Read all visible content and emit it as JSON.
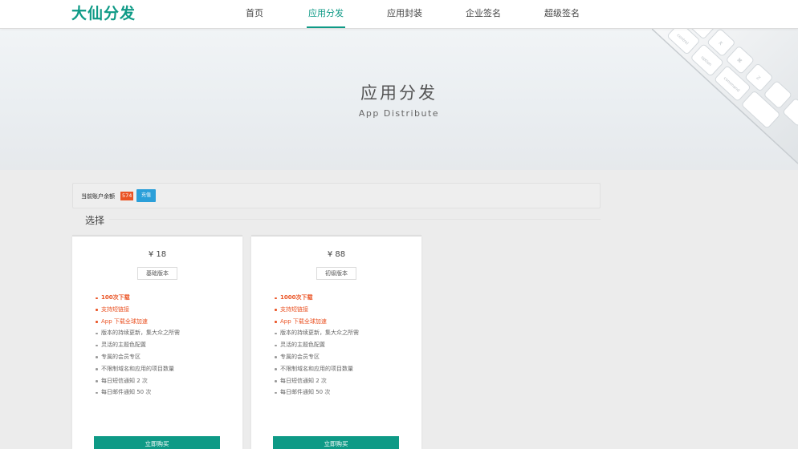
{
  "header": {
    "logo": "大仙分发",
    "nav": [
      {
        "label": "首页",
        "active": false
      },
      {
        "label": "应用分发",
        "active": true
      },
      {
        "label": "应用封装",
        "active": false
      },
      {
        "label": "企业签名",
        "active": false
      },
      {
        "label": "超级签名",
        "active": false
      }
    ]
  },
  "banner": {
    "title": "应用分发",
    "subtitle": "App Distribute",
    "keyboard_keys": [
      "control",
      "option",
      "command",
      "Z",
      "X",
      "⌘",
      "ℤ"
    ]
  },
  "balance": {
    "label": "当前账户余额",
    "value": "574",
    "recharge_label": "充值"
  },
  "section": {
    "title": "选择"
  },
  "plans": [
    {
      "price": "¥ 18",
      "tag": "基础版本",
      "features": [
        "100次下载",
        "支持短链接",
        "App 下载全球加速",
        "版本的持续更新，集大众之所需",
        "灵活的主题色配置",
        "专属的会员专区",
        "不限制域名和应用的项目数量",
        "每日短信通知 2 次",
        "每日邮件通知 50 次"
      ],
      "buy_label": "立即购买"
    },
    {
      "price": "¥ 88",
      "tag": "初级版本",
      "features": [
        "1000次下载",
        "支持短链接",
        "App 下载全球加速",
        "版本的持续更新，集大众之所需",
        "灵活的主题色配置",
        "专属的会员专区",
        "不限制域名和应用的项目数量",
        "每日短信通知 2 次",
        "每日邮件通知 50 次"
      ],
      "buy_label": "立即购买"
    }
  ],
  "colors": {
    "brand": "#0e9a86",
    "highlight": "#ea5324",
    "recharge": "#2b9fd9"
  }
}
